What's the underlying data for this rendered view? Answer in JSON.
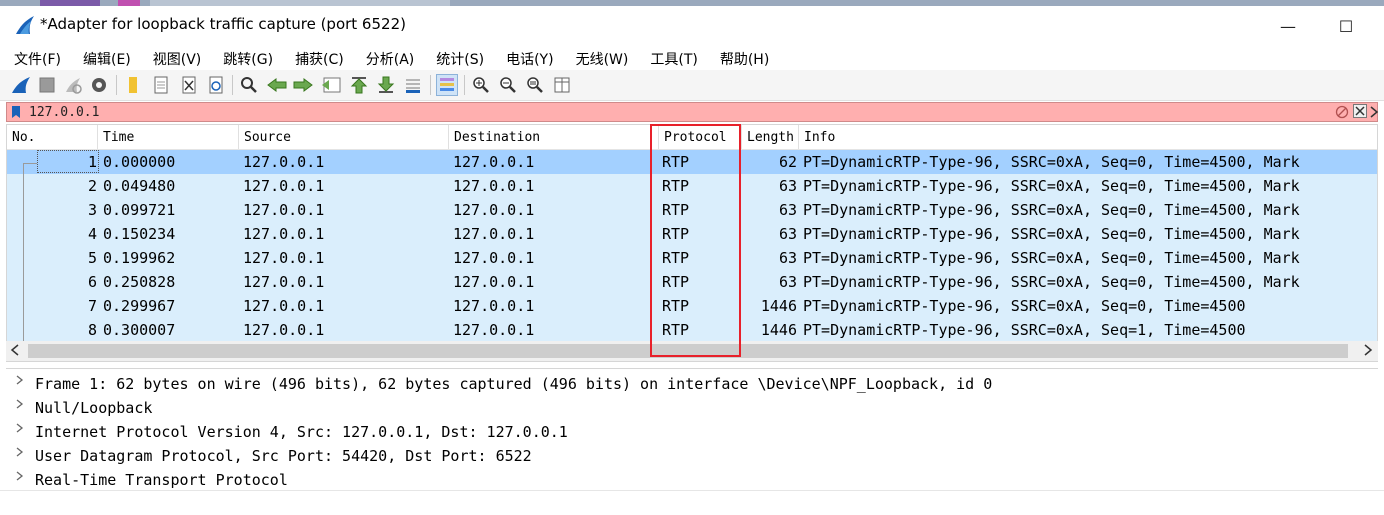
{
  "window": {
    "title": "*Adapter for loopback traffic capture (port 6522)",
    "minimize_glyph": "—",
    "maximize_glyph": "☐"
  },
  "menu": [
    {
      "label": "文件(F)"
    },
    {
      "label": "编辑(E)"
    },
    {
      "label": "视图(V)"
    },
    {
      "label": "跳转(G)"
    },
    {
      "label": "捕获(C)"
    },
    {
      "label": "分析(A)"
    },
    {
      "label": "统计(S)"
    },
    {
      "label": "电话(Y)"
    },
    {
      "label": "无线(W)"
    },
    {
      "label": "工具(T)"
    },
    {
      "label": "帮助(H)"
    }
  ],
  "toolbar": {
    "icons": [
      "shark-fin-start-icon",
      "stop-icon",
      "restart-icon",
      "options-gear-icon",
      "open-file-icon",
      "file-icon",
      "close-file-icon",
      "reload-icon",
      "search-icon",
      "back-arrow-icon",
      "forward-arrow-icon",
      "goto-packet-icon",
      "first-packet-icon",
      "last-packet-icon",
      "autoscroll-icon",
      "colorize-icon",
      "zoom-in-icon",
      "zoom-out-icon",
      "zoom-normal-icon",
      "resize-columns-icon"
    ]
  },
  "filter": {
    "value": "127.0.0.1",
    "invalid_color": "#ffafaf"
  },
  "packet_list": {
    "columns": [
      "No.",
      "Time",
      "Source",
      "Destination",
      "Protocol",
      "Length",
      "Info"
    ],
    "rows": [
      {
        "no": "1",
        "time": "0.000000",
        "source": "127.0.0.1",
        "destination": "127.0.0.1",
        "protocol": "RTP",
        "length": "62",
        "info": "PT=DynamicRTP-Type-96, SSRC=0xA, Seq=0, Time=4500, Mark"
      },
      {
        "no": "2",
        "time": "0.049480",
        "source": "127.0.0.1",
        "destination": "127.0.0.1",
        "protocol": "RTP",
        "length": "63",
        "info": "PT=DynamicRTP-Type-96, SSRC=0xA, Seq=0, Time=4500, Mark"
      },
      {
        "no": "3",
        "time": "0.099721",
        "source": "127.0.0.1",
        "destination": "127.0.0.1",
        "protocol": "RTP",
        "length": "63",
        "info": "PT=DynamicRTP-Type-96, SSRC=0xA, Seq=0, Time=4500, Mark"
      },
      {
        "no": "4",
        "time": "0.150234",
        "source": "127.0.0.1",
        "destination": "127.0.0.1",
        "protocol": "RTP",
        "length": "63",
        "info": "PT=DynamicRTP-Type-96, SSRC=0xA, Seq=0, Time=4500, Mark"
      },
      {
        "no": "5",
        "time": "0.199962",
        "source": "127.0.0.1",
        "destination": "127.0.0.1",
        "protocol": "RTP",
        "length": "63",
        "info": "PT=DynamicRTP-Type-96, SSRC=0xA, Seq=0, Time=4500, Mark"
      },
      {
        "no": "6",
        "time": "0.250828",
        "source": "127.0.0.1",
        "destination": "127.0.0.1",
        "protocol": "RTP",
        "length": "63",
        "info": "PT=DynamicRTP-Type-96, SSRC=0xA, Seq=0, Time=4500, Mark"
      },
      {
        "no": "7",
        "time": "0.299967",
        "source": "127.0.0.1",
        "destination": "127.0.0.1",
        "protocol": "RTP",
        "length": "1446",
        "info": "PT=DynamicRTP-Type-96, SSRC=0xA, Seq=0, Time=4500"
      },
      {
        "no": "8",
        "time": "0.300007",
        "source": "127.0.0.1",
        "destination": "127.0.0.1",
        "protocol": "RTP",
        "length": "1446",
        "info": "PT=DynamicRTP-Type-96, SSRC=0xA, Seq=1, Time=4500"
      }
    ],
    "selected_row": 1,
    "row_color": "#daeefc",
    "selected_color": "#a3d0ff",
    "highlight_color": "#e8202a"
  },
  "details": {
    "items": [
      {
        "text": "Frame 1: 62 bytes on wire (496 bits), 62 bytes captured (496 bits) on interface \\Device\\NPF_Loopback, id 0"
      },
      {
        "text": "Null/Loopback"
      },
      {
        "text": "Internet Protocol Version 4, Src: 127.0.0.1, Dst: 127.0.0.1"
      },
      {
        "text": "User Datagram Protocol, Src Port: 54420, Dst Port: 6522"
      },
      {
        "text": "Real-Time Transport Protocol"
      }
    ]
  }
}
